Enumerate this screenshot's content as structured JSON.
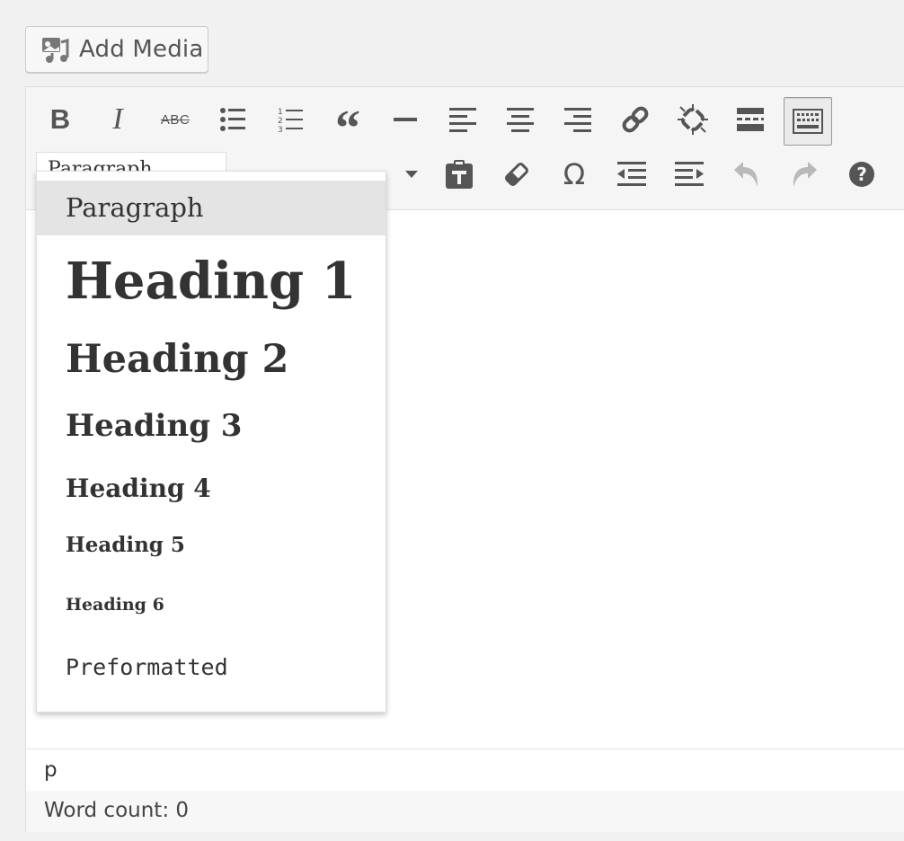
{
  "toolbar": {
    "add_media_label": "Add Media",
    "format_select_value": "Paragraph",
    "strike_label": "ABC"
  },
  "format_menu": {
    "items": [
      {
        "label": "Paragraph",
        "selected": true
      },
      {
        "label": "Heading 1"
      },
      {
        "label": "Heading 2"
      },
      {
        "label": "Heading 3"
      },
      {
        "label": "Heading 4"
      },
      {
        "label": "Heading 5"
      },
      {
        "label": "Heading 6"
      },
      {
        "label": "Preformatted"
      }
    ]
  },
  "path_bar": {
    "path": "p"
  },
  "status_bar": {
    "word_count": "Word count: 0"
  },
  "colors": {
    "toolbar_bg": "#f5f5f5",
    "icon": "#555555",
    "icon_disabled": "#b9b9b9",
    "menu_selected_bg": "#e4e4e4"
  }
}
